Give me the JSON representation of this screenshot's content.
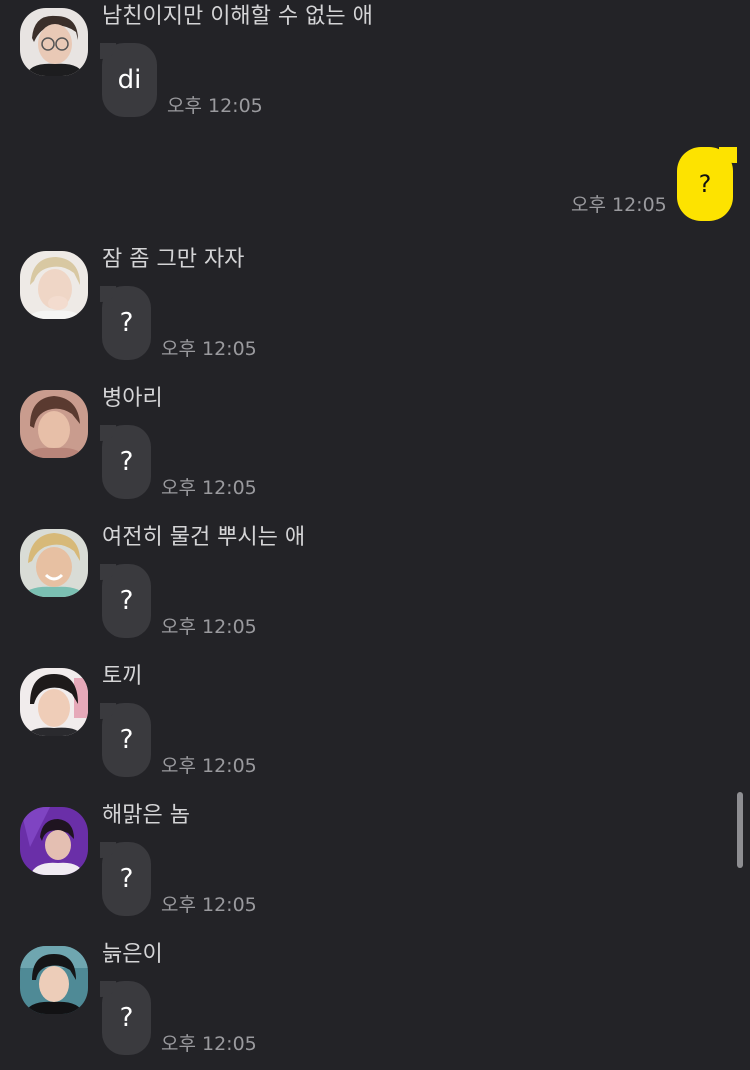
{
  "conversation": {
    "messages": [
      {
        "sender": "남친이지만 이해할 수 없는 애",
        "text": "di",
        "time": "오후 12:05",
        "avatar": "avatar-glasses-boy"
      },
      {
        "sender": "잠 좀 그만 자자",
        "text": "?",
        "time": "오후 12:05",
        "avatar": "avatar-blond-boy"
      },
      {
        "sender": "병아리",
        "text": "?",
        "time": "오후 12:05",
        "avatar": "avatar-brown-hair-boy"
      },
      {
        "sender": "여전히 물건 뿌시는 애",
        "text": "?",
        "time": "오후 12:05",
        "avatar": "avatar-smiling-blond-boy"
      },
      {
        "sender": "토끼",
        "text": "?",
        "time": "오후 12:05",
        "avatar": "avatar-black-hair-boy"
      },
      {
        "sender": "해맑은 놈",
        "text": "?",
        "time": "오후 12:05",
        "avatar": "avatar-purple-background-boy"
      },
      {
        "sender": "늙은이",
        "text": "?",
        "time": "오후 12:05",
        "avatar": "avatar-suit-boy"
      }
    ],
    "my_message": {
      "text": "?",
      "time": "오후 12:05"
    }
  },
  "colors": {
    "background": "#232327",
    "incoming_bubble": "#3a3a3e",
    "outgoing_bubble": "#fde300",
    "timestamp": "#9a9a9e"
  }
}
